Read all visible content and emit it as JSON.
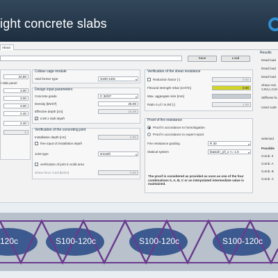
{
  "header": {
    "title": "ight concrete slabs"
  },
  "tabs": [
    {
      "label": "About"
    }
  ],
  "toolbar": {
    "save_label": "Save",
    "load_label": "Load"
  },
  "left": {
    "values": [
      "22,80",
      "3.00",
      "3.00",
      "3.00",
      "2.40",
      "2.40",
      "6"
    ],
    "label_slab_panel": "t slab panel"
  },
  "cage_module": {
    "title": "Cobiax cage module",
    "void_former_label": "Void former type",
    "void_former_value": "S100-120c"
  },
  "design_input": {
    "title": "Design input parameters",
    "concrete_grade_label": "Concrete grade",
    "concrete_grade_value": "C 30/37",
    "density_label": "Density [kN/m³]",
    "density_value": "25.00",
    "effective_depth_label": "Effective depth [cm]",
    "effective_depth_value": "18.38",
    "slab_depth_label": "0.85 x slab depth",
    "slab_depth_checked": "✓"
  },
  "concreting_joint": {
    "title": "Verification of the concreting joint",
    "installation_depth_label": "Installation depth [cm]",
    "installation_depth_value": "4.00",
    "free_input_label": "free input of installation depth",
    "joint_type_label": "Joint type",
    "joint_type_value": "smooth",
    "solid_area_label": "verification of joint in solid area",
    "shear_force_label": "Shear force V,Ed [kN/m]",
    "shear_force_value": "0.00"
  },
  "shear_resistance": {
    "title": "Verification of the shear resistance",
    "reduction_label": "Reduction factor [-]",
    "reduction_value": "0.50",
    "flexural_label": "Flexural strength rebar [cm²/m]",
    "flexural_value": "0.00",
    "aggregate_label": "Max. aggregate size [mm]",
    "aggregate_value": "",
    "ratio_label": "Ratio m,d / m,Rd [-]",
    "ratio_value": "1.00"
  },
  "fire": {
    "title": "Proof of fire resistance",
    "radio_homologation": "Proof in accordance to homologation",
    "radio_expert": "Proof in accordance to expert report",
    "grading_label": "Fire resistance grading",
    "grading_value": "R 30",
    "statical_label": "Statical system",
    "statical_value": "biaxial  l_y/l_x <= 1.5",
    "note": "The proof is considered as provided as soon as one of the four combinations 0, A, B, C or an interpolated intermediate value is maintained."
  },
  "results": {
    "title": "Results",
    "items": [
      "Dead load",
      "Dead load",
      "Dead load",
      "Shear resi",
      "V,Rd,c,Coh",
      "Stiffness fa",
      "Used code"
    ],
    "selected_label": "Selected",
    "possible_label": "Possible",
    "combos": [
      "Comb. 0",
      "Comb. A",
      "Comb. B",
      "Comb. C"
    ]
  },
  "slab_labels": [
    "120c",
    "S100-120c",
    "S100-120c",
    "S100-120c"
  ]
}
